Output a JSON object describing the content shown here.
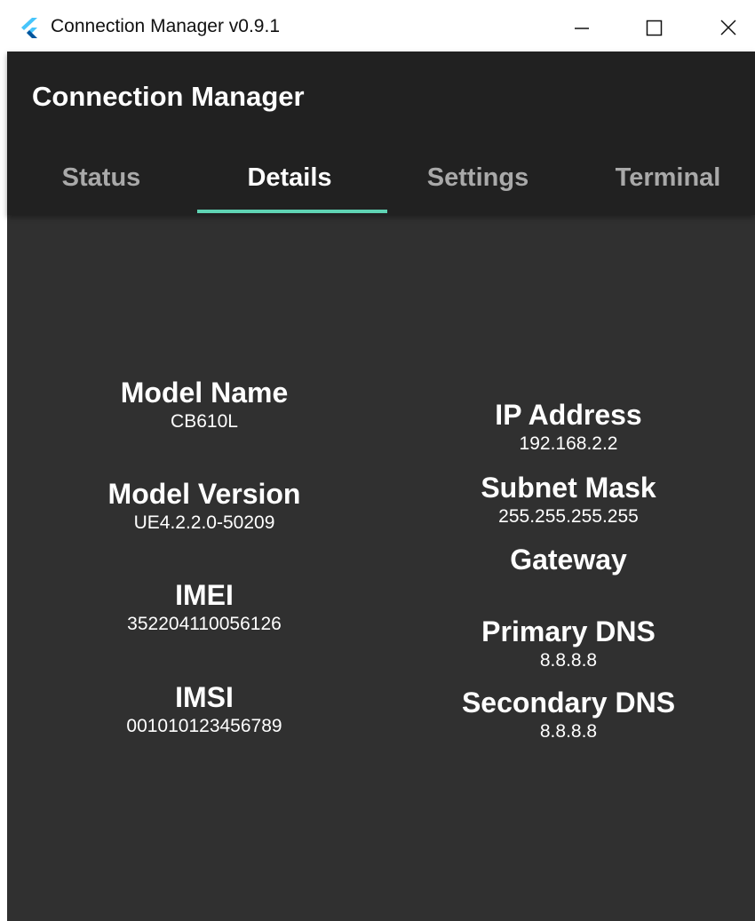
{
  "window": {
    "title": "Connection Manager v0.9.1",
    "controls": {
      "minimize_icon": "minimize-icon",
      "maximize_icon": "maximize-icon",
      "close_icon": "close-icon"
    }
  },
  "appbar": {
    "title": "Connection Manager",
    "tabs": [
      {
        "label": "Status",
        "active": false
      },
      {
        "label": "Details",
        "active": true
      },
      {
        "label": "Settings",
        "active": false
      },
      {
        "label": "Terminal",
        "active": false
      }
    ]
  },
  "details": {
    "device": [
      {
        "label": "Model Name",
        "value": "CB610L"
      },
      {
        "label": "Model Version",
        "value": "UE4.2.2.0-50209"
      },
      {
        "label": "IMEI",
        "value": "352204110056126"
      },
      {
        "label": "IMSI",
        "value": "001010123456789"
      }
    ],
    "network": [
      {
        "label": "IP Address",
        "value": "192.168.2.2"
      },
      {
        "label": "Subnet Mask",
        "value": "255.255.255.255"
      },
      {
        "label": "Gateway",
        "value": ""
      },
      {
        "label": "Primary DNS",
        "value": "8.8.8.8"
      },
      {
        "label": "Secondary DNS",
        "value": "8.8.8.8"
      }
    ]
  },
  "colors": {
    "appbar_bg": "#212121",
    "body_bg": "#303030",
    "tab_indicator": "#5fd3b3",
    "inactive_tab_text": "#a9a9a9",
    "flutter_icon_light": "#47c5fb",
    "flutter_icon_dark": "#00569e"
  }
}
